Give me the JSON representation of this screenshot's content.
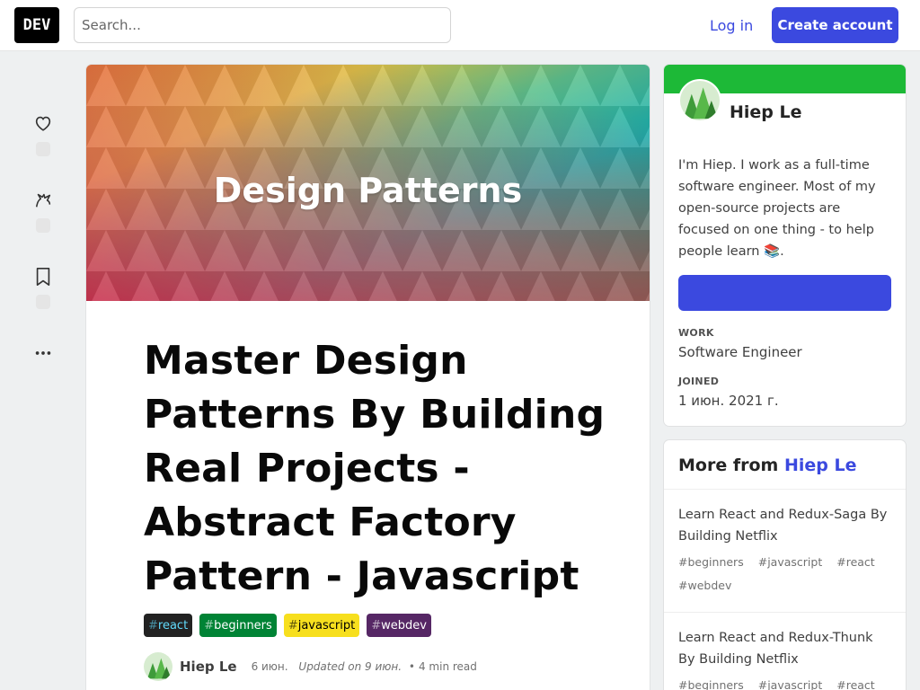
{
  "header": {
    "logo": "DEV",
    "search_placeholder": "Search...",
    "login_label": "Log in",
    "create_account_label": "Create account"
  },
  "reactions": {
    "icons": [
      "heart-icon",
      "unicorn-icon",
      "bookmark-icon",
      "more-icon"
    ]
  },
  "article": {
    "cover_text": "Design Patterns",
    "title": "Master Design Patterns By Building Real Projects - Abstract Factory Pattern - Javascript",
    "tags": [
      {
        "name": "react",
        "bg": "#222222",
        "fg": "#61dafb"
      },
      {
        "name": "beginners",
        "bg": "#008335",
        "fg": "#ffffff"
      },
      {
        "name": "javascript",
        "bg": "#f7df1e",
        "fg": "#000000"
      },
      {
        "name": "webdev",
        "bg": "#562765",
        "fg": "#ffffff"
      }
    ],
    "author": "Hiep Le",
    "date": "6 июн.",
    "updated": "Updated on 9 июн.",
    "read_time": "4 min read"
  },
  "profile": {
    "name": "Hiep Le",
    "bio": "I'm Hiep. I work as a full-time software engineer. Most of my open-source projects are focused on one thing - to help people learn 📚.",
    "follow_label": "",
    "work_label": "WORK",
    "work_value": "Software Engineer",
    "joined_label": "JOINED",
    "joined_value": "1 июн. 2021 г.",
    "brand_color": "#1db937"
  },
  "more_from": {
    "prefix": "More from",
    "author": "Hiep Le",
    "items": [
      {
        "title": "Learn React and Redux-Saga By Building Netflix",
        "tags": [
          "beginners",
          "javascript",
          "react",
          "webdev"
        ]
      },
      {
        "title": "Learn React and Redux-Thunk By Building Netflix",
        "tags": [
          "beginners",
          "javascript",
          "react"
        ]
      }
    ]
  },
  "colors": {
    "accent": "#3b49df",
    "background": "#eef0f1"
  }
}
